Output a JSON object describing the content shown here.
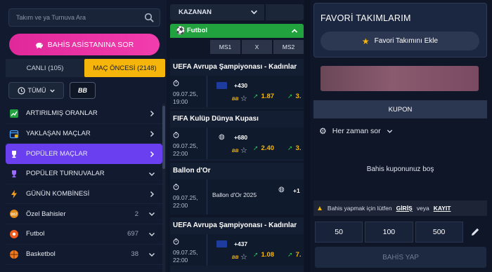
{
  "colors": {
    "accent_yellow": "#f5b50a",
    "brand_pink": "#e0289a",
    "active_purple": "#6a3ff0",
    "football_green": "#21a23e"
  },
  "search": {
    "placeholder": "Takım ve ya Turnuva Ara",
    "icon": "search-icon"
  },
  "assistant_button": {
    "label": "BAHİS ASİSTANINA SOR",
    "icon": "piggy-bank-icon"
  },
  "mode_tabs": {
    "live_label": "CANLI (105)",
    "prematch_label": "MAÇ ÖNCESİ (2148)"
  },
  "filters": {
    "time_label": "TÜMÜ",
    "bb_label": "BB"
  },
  "menu": [
    {
      "label": "ARTIRILMIŞ ORANLAR",
      "icon": "trend-up-icon",
      "arrow": "right",
      "count": ""
    },
    {
      "label": "YAKLAŞAN MAÇLAR",
      "icon": "calendar-icon",
      "arrow": "right",
      "count": ""
    },
    {
      "label": "POPÜLER MAÇLAR",
      "icon": "trophy-icon",
      "arrow": "right",
      "count": "",
      "active": true
    },
    {
      "label": "POPÜLER TURNUVALAR",
      "icon": "trophy-icon",
      "arrow": "down",
      "count": ""
    },
    {
      "label": "GÜNÜN KOMBİNESİ",
      "icon": "lightning-icon",
      "arrow": "right",
      "count": ""
    },
    {
      "label": "Özel Bahisler",
      "icon": "special-bets-icon",
      "arrow": "down",
      "count": "2"
    },
    {
      "label": "Futbol",
      "icon": "football-icon",
      "arrow": "down",
      "count": "697"
    },
    {
      "label": "Basketbol",
      "icon": "basketball-icon",
      "arrow": "down",
      "count": "38"
    }
  ],
  "market": {
    "label": "KAZANAN",
    "sport_label": "Futbol",
    "columns": [
      "MS1",
      "X",
      "MS2"
    ]
  },
  "events": [
    {
      "title": "UEFA Avrupa Şampiyonası - Kadınlar",
      "date": "09.07.25,",
      "time": "19:00",
      "more": "+430",
      "odd1": "1.87",
      "odd2": "3.",
      "flag": "eu-flag-icon"
    },
    {
      "title": "FIFA Kulüp Dünya Kupası",
      "date": "09.07.25,",
      "time": "22:00",
      "more": "+680",
      "odd1": "2.40",
      "odd2": "3.",
      "flag": "globe-icon"
    },
    {
      "title": "Ballon d'Or",
      "date": "09.07.25,",
      "time": "22:00",
      "more": "+1",
      "sub": "Ballon d'Or 2025",
      "flag": "globe-icon"
    },
    {
      "title": "UEFA Avrupa Şampiyonası - Kadınlar",
      "date": "09.07.25,",
      "time": "22:00",
      "more": "+437",
      "odd1": "1.08",
      "odd2": "7.",
      "flag": "eu-flag-icon"
    }
  ],
  "favorites": {
    "title": "FAVORİ TAKIMLARIM",
    "add_label": "Favori Takımını Ekle"
  },
  "coupon": {
    "tab_label": "KUPON",
    "accept_odds_label": "Her zaman sor",
    "empty_text": "Bahis kuponunuz boş",
    "warning_text": "Bahis yapmak için lütfen",
    "login_label": "GİRİŞ",
    "or_label": "veya",
    "register_label": "KAYIT",
    "amounts": [
      "50",
      "100",
      "500"
    ],
    "place_bet_label": "BAHİS YAP"
  }
}
